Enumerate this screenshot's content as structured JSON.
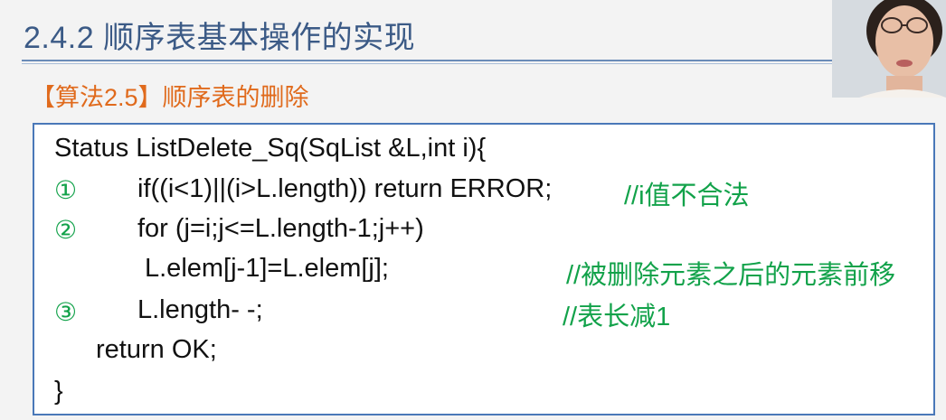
{
  "slide": {
    "title": "2.4.2 顺序表基本操作的实现",
    "algorithm_heading": "【算法2.5】顺序表的删除"
  },
  "code": {
    "signature": "Status ListDelete_Sq(SqList &L,int i){",
    "lines": [
      {
        "marker": "①",
        "code": "if((i<1)||(i>L.length)) return ERROR;",
        "comment": "//i值不合法"
      },
      {
        "marker": "②",
        "code": "for (j=i;j<=L.length-1;j++)",
        "comment": ""
      },
      {
        "marker": "",
        "code": "L.elem[j-1]=L.elem[j];",
        "comment": "//被删除元素之后的元素前移"
      },
      {
        "marker": "③",
        "code": "L.length- -;",
        "comment": "//表长减1"
      }
    ],
    "return_line": "return OK;",
    "close_brace": "}"
  },
  "colors": {
    "title": "#3b5a86",
    "heading": "#e06a1c",
    "comment": "#12a24a",
    "box_border": "#4a78b8"
  },
  "webcam": {
    "icon": "presenter-video"
  }
}
